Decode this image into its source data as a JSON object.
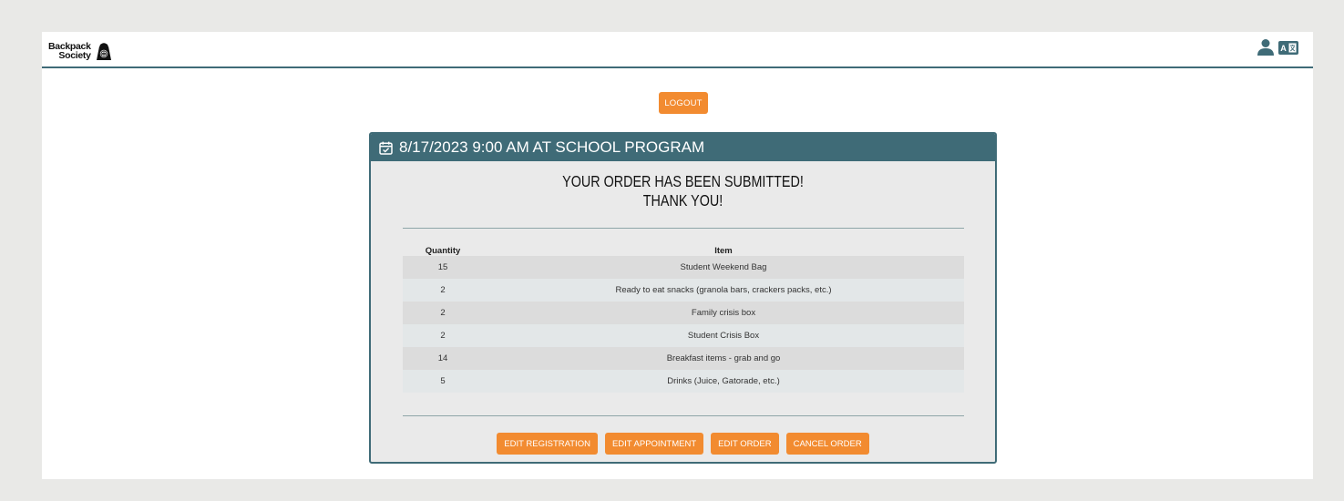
{
  "header": {
    "logo_line1": "Backpack",
    "logo_line2": "Society",
    "user_icon": "user-icon",
    "language_icon": "translate-icon",
    "language_badge": "A"
  },
  "logout_label": "LOGOUT",
  "appointment": {
    "title": "8/17/2023 9:00 AM AT SCHOOL PROGRAM",
    "message_line1": "YOUR ORDER HAS BEEN SUBMITTED!",
    "message_line2": "THANK YOU!"
  },
  "table": {
    "headers": [
      "Quantity",
      "Item"
    ],
    "rows": [
      {
        "qty": "15",
        "item": "Student Weekend Bag"
      },
      {
        "qty": "2",
        "item": "Ready to eat snacks (granola bars, crackers packs, etc.)"
      },
      {
        "qty": "2",
        "item": "Family crisis box"
      },
      {
        "qty": "2",
        "item": "Student Crisis Box"
      },
      {
        "qty": "14",
        "item": "Breakfast items - grab and go"
      },
      {
        "qty": "5",
        "item": "Drinks (Juice, Gatorade, etc.)"
      }
    ]
  },
  "actions": {
    "edit_registration": "EDIT REGISTRATION",
    "edit_appointment": "EDIT APPOINTMENT",
    "edit_order": "EDIT ORDER",
    "cancel_order": "CANCEL ORDER"
  },
  "colors": {
    "accent": "#f28b30",
    "primary": "#3f6b77",
    "background": "#e9e9e7"
  }
}
